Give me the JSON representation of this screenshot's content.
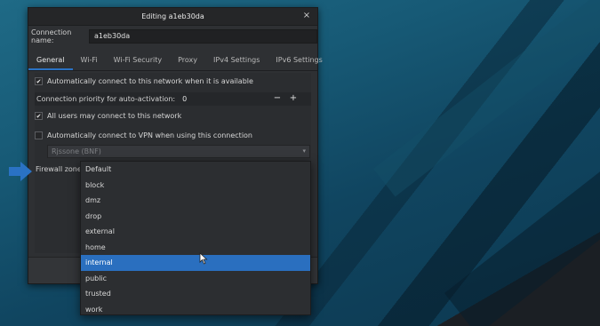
{
  "window": {
    "title": "Editing a1eb30da",
    "close_glyph": "×"
  },
  "connection_name": {
    "label": "Connection name:",
    "value": "a1eb30da"
  },
  "tabs": [
    {
      "label": "General",
      "active": true
    },
    {
      "label": "Wi-Fi"
    },
    {
      "label": "Wi-Fi Security"
    },
    {
      "label": "Proxy"
    },
    {
      "label": "IPv4 Settings"
    },
    {
      "label": "IPv6 Settings"
    }
  ],
  "general": {
    "auto_connect": {
      "label": "Automatically connect to this network when it is available",
      "checked": true
    },
    "priority": {
      "label": "Connection priority for auto-activation:",
      "value": "0",
      "minus": "−",
      "plus": "+"
    },
    "all_users": {
      "label": "All users may connect to this network",
      "checked": true
    },
    "vpn_auto": {
      "label": "Automatically connect to VPN when using this connection",
      "checked": false
    },
    "vpn_select": {
      "value": "Rjssone (BNF)"
    },
    "firewall": {
      "label": "Firewall zone:"
    }
  },
  "firewall_dropdown": {
    "options": [
      "Default",
      "block",
      "dmz",
      "drop",
      "external",
      "home",
      "internal",
      "public",
      "trusted",
      "work"
    ],
    "highlighted": "internal"
  },
  "colors": {
    "accent": "#2a6fbf",
    "arrow_indicator": "#2a72c4"
  },
  "icons": {
    "close": "close-icon",
    "checkbox_check": "check-icon",
    "select_arrow": "chevron-down-icon",
    "cursor": "mouse-pointer-icon",
    "indicator": "arrow-right-icon"
  }
}
